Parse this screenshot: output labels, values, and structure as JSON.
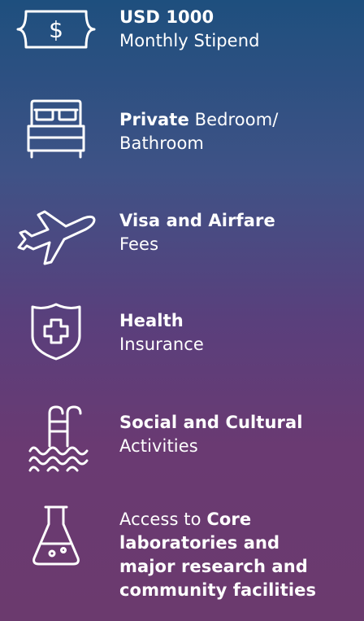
{
  "benefits": [
    {
      "icon": "dollar-bill-icon",
      "line1_bold": "USD 1000",
      "line2": "Monthly Stipend"
    },
    {
      "icon": "bed-icon",
      "line1_bold": "Private",
      "line1_rest": " Bedroom/",
      "line2": "Bathroom"
    },
    {
      "icon": "airplane-icon",
      "line1_bold": "Visa and Airfare",
      "line2": "Fees"
    },
    {
      "icon": "health-shield-icon",
      "line1_bold": "Health",
      "line2": "Insurance"
    },
    {
      "icon": "pool-ladder-icon",
      "line1_bold": "Social and Cultural",
      "line2": "Activities"
    },
    {
      "icon": "lab-flask-icon",
      "line1_prefix": "Access to ",
      "line1_bold": "Core",
      "line2_bold": "laboratories and",
      "line3_bold": "major research and",
      "line4_bold": "community facilities"
    }
  ],
  "colors": {
    "text": "#ffffff",
    "gradient_top": "#1e4f7e",
    "gradient_bottom": "#6b3a6e"
  }
}
